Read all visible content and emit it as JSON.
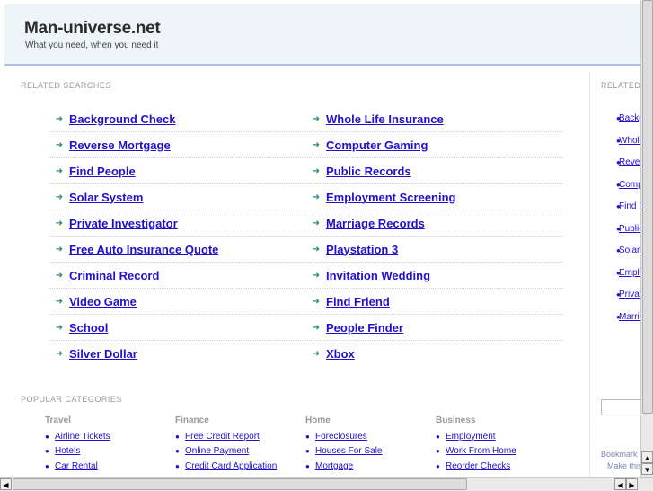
{
  "header": {
    "title": "Man-universe.net",
    "tagline": "What you need, when you need it"
  },
  "related": {
    "heading": "RELATED SEARCHES",
    "left": [
      "Background Check",
      "Reverse Mortgage",
      "Find People",
      "Solar System",
      "Private Investigator",
      "Free Auto Insurance Quote",
      "Criminal Record",
      "Video Game",
      "School",
      "Silver Dollar"
    ],
    "right": [
      "Whole Life Insurance",
      "Computer Gaming",
      "Public Records",
      "Employment Screening",
      "Marriage Records",
      "Playstation 3",
      "Invitation Wedding",
      "Find Friend",
      "People Finder",
      "Xbox"
    ]
  },
  "popular": {
    "heading": "POPULAR CATEGORIES",
    "categories": [
      {
        "name": "Travel",
        "links": [
          "Airline Tickets",
          "Hotels",
          "Car Rental"
        ]
      },
      {
        "name": "Finance",
        "links": [
          "Free Credit Report",
          "Online Payment",
          "Credit Card Application"
        ]
      },
      {
        "name": "Home",
        "links": [
          "Foreclosures",
          "Houses For Sale",
          "Mortgage"
        ]
      },
      {
        "name": "Business",
        "links": [
          "Employment",
          "Work From Home",
          "Reorder Checks"
        ]
      }
    ]
  },
  "sidebar": {
    "heading": "RELATED",
    "links": [
      "Background Check",
      "Whole Life Insurance",
      "Reverse Mortgage",
      "Computer Gaming",
      "Find People",
      "Public Records",
      "Solar System",
      "Employment Screening",
      "Private Investigator",
      "Marriage Records"
    ],
    "bookmark": "Bookmark",
    "make": "Make this"
  }
}
